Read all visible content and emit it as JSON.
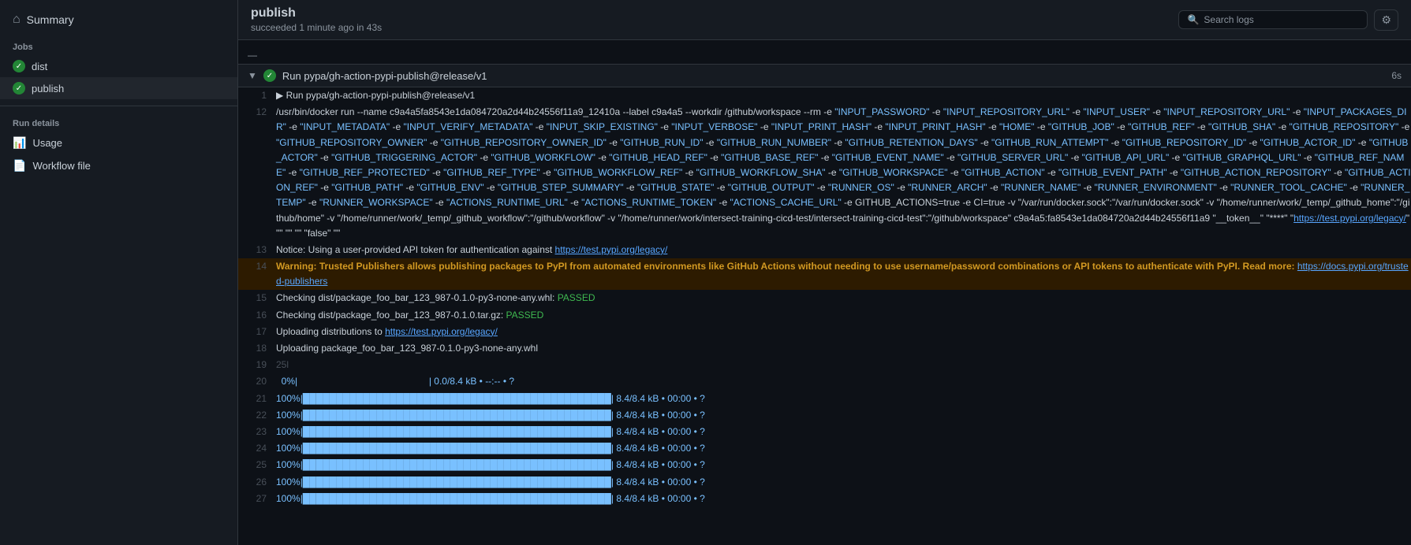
{
  "sidebar": {
    "summary_label": "Summary",
    "jobs_label": "Jobs",
    "job_dist": "dist",
    "job_publish": "publish",
    "run_details_label": "Run details",
    "nav_usage": "Usage",
    "nav_workflow": "Workflow file"
  },
  "topbar": {
    "title": "publish",
    "subtitle": "succeeded 1 minute ago in 43s",
    "search_placeholder": "Search logs"
  },
  "step": {
    "title": "Run pypa/gh-action-pypi-publish@release/v1",
    "duration": "6s"
  },
  "lines": [
    {
      "num": 1,
      "text": "▶ Run pypa/gh-action-pypi-publish@release/v1",
      "type": "normal"
    },
    {
      "num": 12,
      "text": "/usr/bin/docker run --name c9a4a5fa8543e1da084720a2d44b24556f11a9_12410a --label c9a4a5 --workdir /github/workspace --rm -e \"INPUT_PASSWORD\" -e \"INPUT_REPOSITORY_URL\" -e \"INPUT_USER\" -e \"INPUT_REPOSITORY_URL\" -e \"INPUT_PACKAGES_DIR\" -e \"INPUT_METADATA\" -e \"INPUT_VERIFY_METADATA\" -e \"INPUT_SKIP_EXISTING\" -e \"INPUT_VERBOSE\" -e \"INPUT_PRINT_HASH\" -e \"INPUT_PRINT_HASH\" -e \"HOME\" -e \"GITHUB_JOB\" -e \"GITHUB_REF\" -e \"GITHUB_SHA\" -e \"GITHUB_REPOSITORY\" -e \"GITHUB_REPOSITORY_OWNER\" -e \"GITHUB_REPOSITORY_OWNER_ID\" -e \"GITHUB_RUN_ID\" -e \"GITHUB_RUN_NUMBER\" -e \"GITHUB_RETENTION_DAYS\" -e \"GITHUB_RUN_ATTEMPT\" -e \"GITHUB_REPOSITORY_ID\" -e \"GITHUB_ACTOR_ID\" -e \"GITHUB_ACTOR\" -e \"GITHUB_TRIGGERING_ACTOR\" -e \"GITHUB_WORKFLOW\" -e \"GITHUB_HEAD_REF\" -e \"GITHUB_BASE_REF\" -e \"GITHUB_EVENT_NAME\" -e \"GITHUB_SERVER_URL\" -e \"GITHUB_API_URL\" -e \"GITHUB_GRAPHQL_URL\" -e \"GITHUB_REF_NAME\" -e \"GITHUB_REF_PROTECTED\" -e \"GITHUB_REF_TYPE\" -e \"GITHUB_WORKFLOW_REF\" -e \"GITHUB_WORKFLOW_SHA\" -e \"GITHUB_WORKSPACE\" -e \"GITHUB_ACTION\" -e \"GITHUB_EVENT_PATH\" -e \"GITHUB_ACTION_REPOSITORY\" -e \"GITHUB_ACTION_REF\" -e \"GITHUB_PATH\" -e \"GITHUB_ENV\" -e \"GITHUB_STEP_SUMMARY\" -e \"GITHUB_STATE\" -e \"GITHUB_OUTPUT\" -e \"RUNNER_OS\" -e \"RUNNER_ARCH\" -e \"RUNNER_NAME\" -e \"RUNNER_ENVIRONMENT\" -e \"RUNNER_TOOL_CACHE\" -e \"RUNNER_TEMP\" -e \"RUNNER_WORKSPACE\" -e \"ACTIONS_RUNTIME_URL\" -e \"ACTIONS_RUNTIME_TOKEN\" -e \"ACTIONS_CACHE_URL\" -e GITHUB_ACTIONS=true -e CI=true -v \"/var/run/docker.sock\":\"/var/run/docker.sock\" -v \"/home/runner/work/_temp/_github_home\":\"/github/home\" -v \"/home/runner/work/_temp/_github_workflow\":\"/github/workflow\" -v \"/home/runner/work/intersect-training-cicd-test/intersect-training-cicd-test\":\"/github/workspace\" c9a4a5:fa8543e1da084720a2d44b24556f11a9 \"__token__\" \"****\" \"https://test.pypi.org/legacy/\" \"\" \"\" \"\" \"false\" \"\"",
      "type": "normal"
    },
    {
      "num": 13,
      "text": "Notice: Using a user-provided API token for authentication against https://test.pypi.org/legacy/",
      "type": "normal"
    },
    {
      "num": 14,
      "text": "Warning: Trusted Publishers allows publishing packages to PyPI from automated environments like GitHub Actions without needing to use username/password combinations or API tokens to authenticate with PyPI. Read more: https://docs.pypi.org/trusted-publishers",
      "type": "warning"
    },
    {
      "num": 15,
      "text": "Checking dist/package_foo_bar_123_987-0.1.0-py3-none-any.whl: PASSED",
      "type": "passed"
    },
    {
      "num": 16,
      "text": "Checking dist/package_foo_bar_123_987-0.1.0.tar.gz: PASSED",
      "type": "passed"
    },
    {
      "num": 17,
      "text": "Uploading distributions to https://test.pypi.org/legacy/",
      "type": "link"
    },
    {
      "num": 18,
      "text": "Uploading package_foo_bar_123_987-0.1.0-py3-none-any.whl",
      "type": "normal"
    },
    {
      "num": 19,
      "text": "25l",
      "type": "dim"
    },
    {
      "num": 20,
      "text": "  0%|                                                  | 0.0/8.4 kB • --:-- • ?",
      "type": "progress"
    },
    {
      "num": 21,
      "text": "100%|██████████████████████████████████████████████| 8.4/8.4 kB • 00:00 • ?",
      "type": "progress"
    },
    {
      "num": 22,
      "text": "100%|██████████████████████████████████████████████| 8.4/8.4 kB • 00:00 • ?",
      "type": "progress"
    },
    {
      "num": 23,
      "text": "100%|██████████████████████████████████████████████| 8.4/8.4 kB • 00:00 • ?",
      "type": "progress"
    },
    {
      "num": 24,
      "text": "100%|██████████████████████████████████████████████| 8.4/8.4 kB • 00:00 • ?",
      "type": "progress"
    },
    {
      "num": 25,
      "text": "100%|██████████████████████████████████████████████| 8.4/8.4 kB • 00:00 • ?",
      "type": "progress"
    },
    {
      "num": 26,
      "text": "100%|██████████████████████████████████████████████| 8.4/8.4 kB • 00:00 • ?",
      "type": "progress"
    },
    {
      "num": 27,
      "text": "100%|██████████████████████████████████████████████| 8.4/8.4 kB • 00:00 • ?",
      "type": "progress"
    }
  ]
}
